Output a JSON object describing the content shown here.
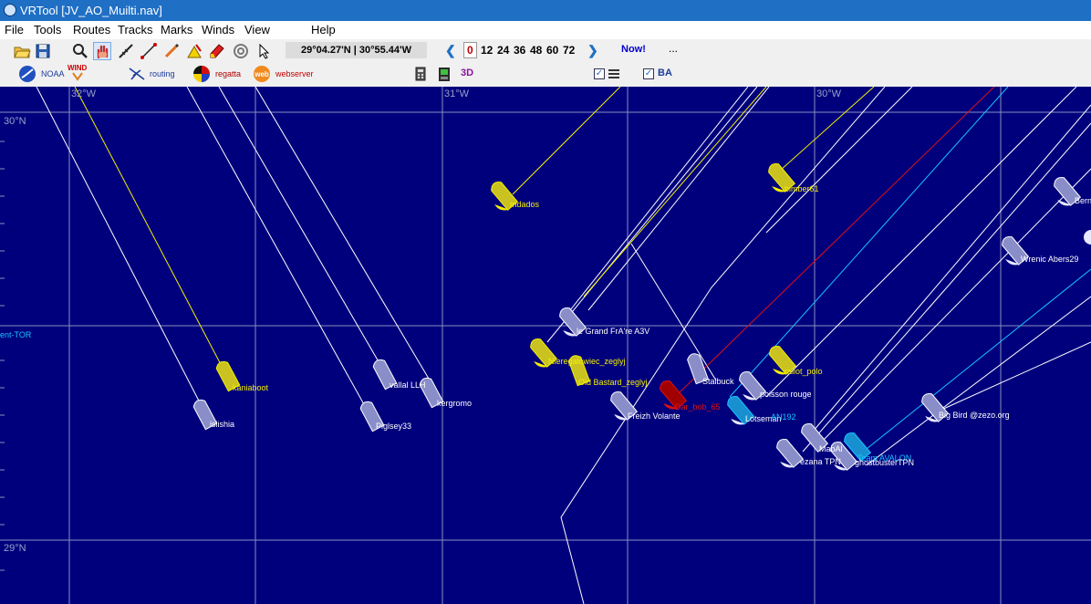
{
  "window": {
    "title": "VRTool [JV_AO_Muilti.nav]"
  },
  "menu": [
    "File",
    "Tools",
    "Routes",
    "Tracks",
    "Marks",
    "Winds",
    "View",
    "Help"
  ],
  "toolbar": {
    "position_readout": "29°04.27'N | 30°55.44'W",
    "forecast_hours": [
      "0",
      "12",
      "24",
      "36",
      "48",
      "60",
      "72"
    ],
    "selected_hour": "0",
    "now_label": "Now!",
    "more_label": "..."
  },
  "toolbar2": {
    "noaa_label": "NOAA",
    "wind_label": "WIND",
    "routing_label": "routing",
    "regatta_label": "regatta",
    "web_icon_text": "web",
    "webserver_label": "webserver",
    "threed_label": "3D",
    "ba_label": "BA"
  },
  "map": {
    "grid_labels": {
      "lon1": "32°W",
      "lon2": "31°W",
      "lon3": "30°W",
      "lat1": "30°N",
      "lat2": "29°N"
    },
    "edge_label": "ent-TOR",
    "colors": {
      "sea": "#00007d",
      "grid": "#8a8fc0",
      "track_white": "#ffffff",
      "track_yellow": "#f5f000",
      "track_red": "#e01010",
      "track_cyan": "#18c4ff"
    },
    "boats": [
      {
        "name": "mdados",
        "color": "yellow"
      },
      {
        "name": "bimber61",
        "color": "yellow"
      },
      {
        "name": "Bern",
        "color": "white"
      },
      {
        "name": "Wrenic Abers29",
        "color": "white"
      },
      {
        "name": "le Grand FrA're A3V",
        "color": "white"
      },
      {
        "name": "Nieregalowiec_zeglyj",
        "color": "yellow"
      },
      {
        "name": "Old Bastard_zeglyj",
        "color": "yellow"
      },
      {
        "name": "kaniaboot",
        "color": "yellow"
      },
      {
        "name": "islishia",
        "color": "white"
      },
      {
        "name": "vallal LLH",
        "color": "white"
      },
      {
        "name": "Piglsey33",
        "color": "white"
      },
      {
        "name": "kergromo",
        "color": "white"
      },
      {
        "name": "Stalbuck",
        "color": "white"
      },
      {
        "name": "Dar_bob_65",
        "color": "red"
      },
      {
        "name": "Freizh Volante",
        "color": "white"
      },
      {
        "name": "raliot_polo",
        "color": "yellow"
      },
      {
        "name": "poisson rouge",
        "color": "white"
      },
      {
        "name": "Lotseman",
        "color": "white"
      },
      {
        "name": "AN192",
        "color": "cyan"
      },
      {
        "name": "Big Bird @zezo.org",
        "color": "white"
      },
      {
        "name": "MabAl",
        "color": "white"
      },
      {
        "name": "ezana TPN",
        "color": "white"
      },
      {
        "name": "Team AVALON",
        "color": "cyan"
      },
      {
        "name": "ghostbusterTPN",
        "color": "white"
      }
    ]
  }
}
